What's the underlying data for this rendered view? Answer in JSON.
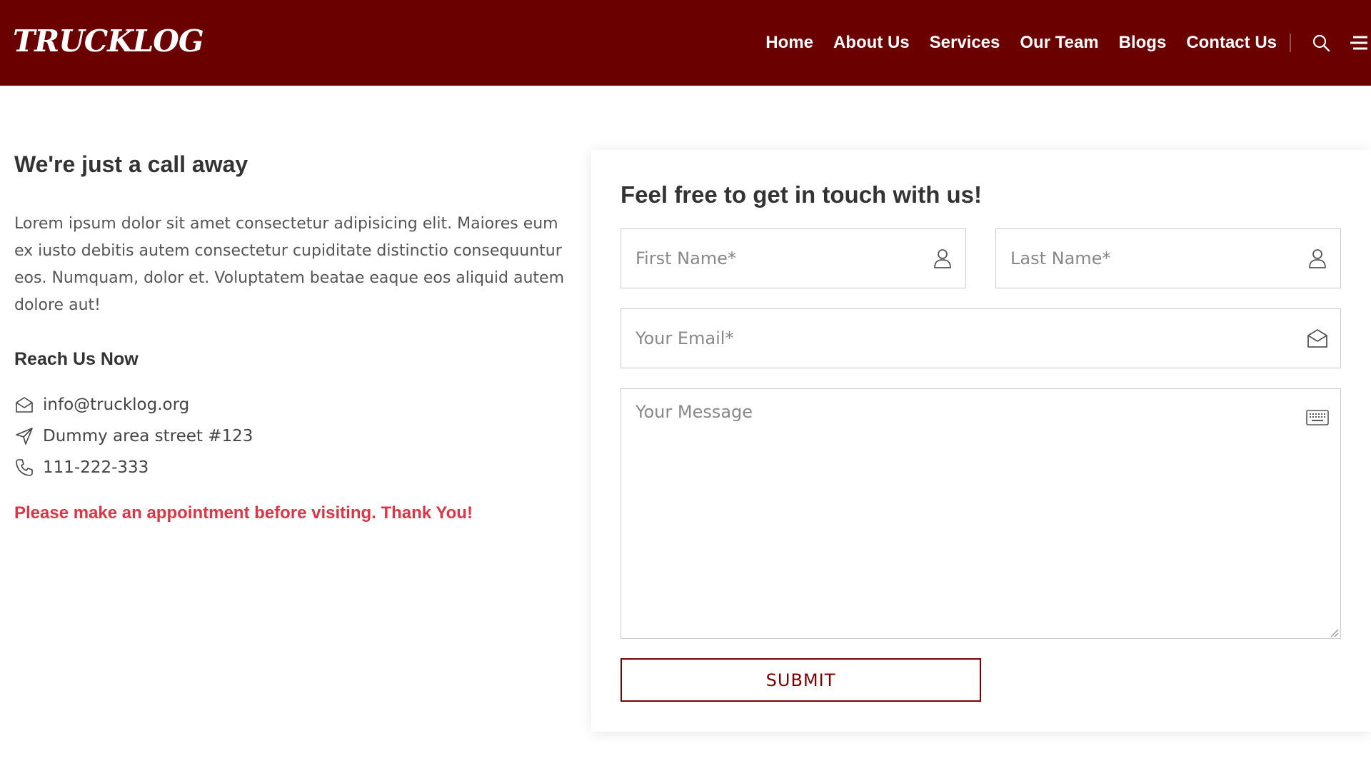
{
  "brand": {
    "logo_text": "TRUCKLOG",
    "primary_color": "#6b0000",
    "accent_color": "#7a0000",
    "notice_color": "#dc3545"
  },
  "nav": {
    "items": [
      {
        "label": "Home"
      },
      {
        "label": "About Us"
      },
      {
        "label": "Services"
      },
      {
        "label": "Our Team"
      },
      {
        "label": "Blogs"
      },
      {
        "label": "Contact Us"
      }
    ],
    "search_icon": "search-icon",
    "menu_icon": "menu-icon"
  },
  "intro": {
    "title": "We're just a call away",
    "text": "Lorem ipsum dolor sit amet consectetur adipisicing elit. Maiores eum ex iusto debitis autem consectetur cupiditate distinctio consequuntur eos. Numquam, dolor et. Voluptatem beatae eaque eos aliquid autem dolore aut!"
  },
  "reach": {
    "title": "Reach Us Now",
    "email": "info@trucklog.org",
    "address": "Dummy area street #123",
    "phone": "111-222-333",
    "notice": "Please make an appointment before visiting. Thank You!"
  },
  "form": {
    "title": "Feel free to get in touch with us!",
    "first_name": {
      "placeholder": "First Name*",
      "value": "",
      "icon": "user-icon"
    },
    "last_name": {
      "placeholder": "Last Name*",
      "value": "",
      "icon": "user-icon"
    },
    "email": {
      "placeholder": "Your Email*",
      "value": "",
      "icon": "envelope-icon"
    },
    "message": {
      "placeholder": "Your Message",
      "value": "",
      "icon": "keyboard-icon"
    },
    "submit_label": "SUBMIT"
  }
}
